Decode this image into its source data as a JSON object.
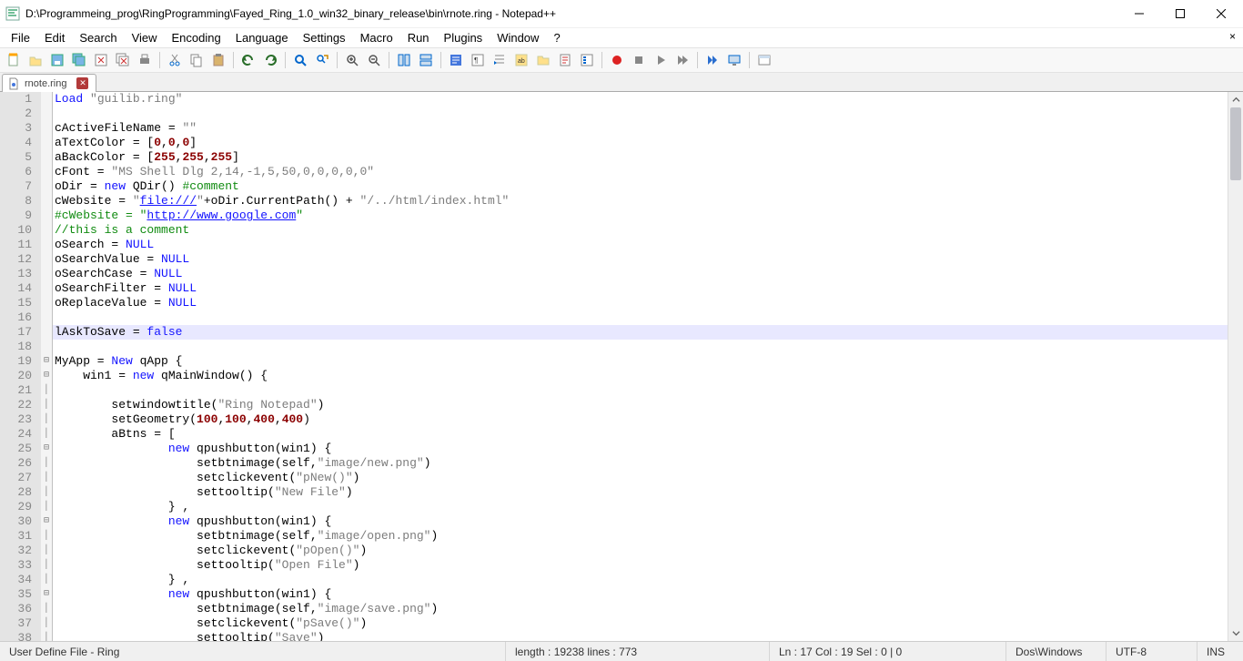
{
  "window": {
    "title": "D:\\Programmeing_prog\\RingProgramming\\Fayed_Ring_1.0_win32_binary_release\\bin\\rnote.ring - Notepad++"
  },
  "menu": {
    "items": [
      "File",
      "Edit",
      "Search",
      "View",
      "Encoding",
      "Language",
      "Settings",
      "Macro",
      "Run",
      "Plugins",
      "Window",
      "?"
    ]
  },
  "tab": {
    "name": "rnote.ring"
  },
  "code": {
    "lines": [
      {
        "n": 1,
        "fold": "",
        "segs": [
          [
            "kw",
            "Load"
          ],
          [
            "",
            " "
          ],
          [
            "str",
            "\"guilib.ring\""
          ]
        ]
      },
      {
        "n": 2,
        "fold": "",
        "segs": [
          [
            "",
            ""
          ]
        ]
      },
      {
        "n": 3,
        "fold": "",
        "segs": [
          [
            "",
            "cActiveFileName = "
          ],
          [
            "str",
            "\"\""
          ]
        ]
      },
      {
        "n": 4,
        "fold": "",
        "segs": [
          [
            "",
            "aTextColor = ["
          ],
          [
            "num",
            "0"
          ],
          [
            "",
            ","
          ],
          [
            "num",
            "0"
          ],
          [
            "",
            ","
          ],
          [
            "num",
            "0"
          ],
          [
            "",
            "]"
          ]
        ]
      },
      {
        "n": 5,
        "fold": "",
        "segs": [
          [
            "",
            "aBackColor = ["
          ],
          [
            "num",
            "255"
          ],
          [
            "",
            ","
          ],
          [
            "num",
            "255"
          ],
          [
            "",
            ","
          ],
          [
            "num",
            "255"
          ],
          [
            "",
            "]"
          ]
        ]
      },
      {
        "n": 6,
        "fold": "",
        "segs": [
          [
            "",
            "cFont = "
          ],
          [
            "str",
            "\"MS Shell Dlg 2,14,-1,5,50,0,0,0,0,0\""
          ]
        ]
      },
      {
        "n": 7,
        "fold": "",
        "segs": [
          [
            "",
            "oDir = "
          ],
          [
            "kw",
            "new"
          ],
          [
            "",
            " QDir() "
          ],
          [
            "cmt",
            "#comment"
          ]
        ]
      },
      {
        "n": 8,
        "fold": "",
        "segs": [
          [
            "",
            "cWebsite = "
          ],
          [
            "str",
            "\""
          ],
          [
            "lnk",
            "file:///"
          ],
          [
            "str",
            "\""
          ],
          [
            "",
            "+oDir.CurrentPath() + "
          ],
          [
            "str",
            "\"/../html/index.html\""
          ]
        ]
      },
      {
        "n": 9,
        "fold": "",
        "segs": [
          [
            "cmt",
            "#cWebsite = \""
          ],
          [
            "lnk",
            "http://www.google.com"
          ],
          [
            "cmt",
            "\""
          ]
        ]
      },
      {
        "n": 10,
        "fold": "",
        "segs": [
          [
            "cmt",
            "//this is a comment"
          ]
        ]
      },
      {
        "n": 11,
        "fold": "",
        "segs": [
          [
            "",
            "oSearch = "
          ],
          [
            "nul",
            "NULL"
          ]
        ]
      },
      {
        "n": 12,
        "fold": "",
        "segs": [
          [
            "",
            "oSearchValue = "
          ],
          [
            "nul",
            "NULL"
          ]
        ]
      },
      {
        "n": 13,
        "fold": "",
        "segs": [
          [
            "",
            "oSearchCase = "
          ],
          [
            "nul",
            "NULL"
          ]
        ]
      },
      {
        "n": 14,
        "fold": "",
        "segs": [
          [
            "",
            "oSearchFilter = "
          ],
          [
            "nul",
            "NULL"
          ]
        ]
      },
      {
        "n": 15,
        "fold": "",
        "segs": [
          [
            "",
            "oReplaceValue = "
          ],
          [
            "nul",
            "NULL"
          ]
        ]
      },
      {
        "n": 16,
        "fold": "",
        "segs": [
          [
            "",
            ""
          ]
        ]
      },
      {
        "n": 17,
        "hl": true,
        "fold": "",
        "segs": [
          [
            "",
            "lAskToSave = "
          ],
          [
            "kw",
            "false"
          ]
        ]
      },
      {
        "n": 18,
        "fold": "",
        "segs": [
          [
            "",
            ""
          ]
        ]
      },
      {
        "n": 19,
        "fold": "⊟",
        "segs": [
          [
            "",
            "MyApp = "
          ],
          [
            "kw",
            "New"
          ],
          [
            "",
            " qApp {"
          ]
        ]
      },
      {
        "n": 20,
        "fold": "⊟",
        "segs": [
          [
            "",
            "    win1 = "
          ],
          [
            "kw",
            "new"
          ],
          [
            "",
            " qMainWindow() {"
          ]
        ]
      },
      {
        "n": 21,
        "fold": "│",
        "segs": [
          [
            "",
            ""
          ]
        ]
      },
      {
        "n": 22,
        "fold": "│",
        "segs": [
          [
            "",
            "        setwindowtitle("
          ],
          [
            "str",
            "\"Ring Notepad\""
          ],
          [
            "",
            ")"
          ]
        ]
      },
      {
        "n": 23,
        "fold": "│",
        "segs": [
          [
            "",
            "        setGeometry("
          ],
          [
            "num",
            "100"
          ],
          [
            "",
            ","
          ],
          [
            "num",
            "100"
          ],
          [
            "",
            ","
          ],
          [
            "num",
            "400"
          ],
          [
            "",
            ","
          ],
          [
            "num",
            "400"
          ],
          [
            "",
            ")"
          ]
        ]
      },
      {
        "n": 24,
        "fold": "│",
        "segs": [
          [
            "",
            "        aBtns = ["
          ]
        ]
      },
      {
        "n": 25,
        "fold": "⊟",
        "segs": [
          [
            "",
            "                "
          ],
          [
            "kw",
            "new"
          ],
          [
            "",
            " qpushbutton(win1) {"
          ]
        ]
      },
      {
        "n": 26,
        "fold": "│",
        "segs": [
          [
            "",
            "                    setbtnimage(self,"
          ],
          [
            "str",
            "\"image/new.png\""
          ],
          [
            "",
            ")"
          ]
        ]
      },
      {
        "n": 27,
        "fold": "│",
        "segs": [
          [
            "",
            "                    setclickevent("
          ],
          [
            "str",
            "\"pNew()\""
          ],
          [
            "",
            ")"
          ]
        ]
      },
      {
        "n": 28,
        "fold": "│",
        "segs": [
          [
            "",
            "                    settooltip("
          ],
          [
            "str",
            "\"New File\""
          ],
          [
            "",
            ")"
          ]
        ]
      },
      {
        "n": 29,
        "fold": "│",
        "segs": [
          [
            "",
            "                } ,"
          ]
        ]
      },
      {
        "n": 30,
        "fold": "⊟",
        "segs": [
          [
            "",
            "                "
          ],
          [
            "kw",
            "new"
          ],
          [
            "",
            " qpushbutton(win1) {"
          ]
        ]
      },
      {
        "n": 31,
        "fold": "│",
        "segs": [
          [
            "",
            "                    setbtnimage(self,"
          ],
          [
            "str",
            "\"image/open.png\""
          ],
          [
            "",
            ")"
          ]
        ]
      },
      {
        "n": 32,
        "fold": "│",
        "segs": [
          [
            "",
            "                    setclickevent("
          ],
          [
            "str",
            "\"pOpen()\""
          ],
          [
            "",
            ")"
          ]
        ]
      },
      {
        "n": 33,
        "fold": "│",
        "segs": [
          [
            "",
            "                    settooltip("
          ],
          [
            "str",
            "\"Open File\""
          ],
          [
            "",
            ")"
          ]
        ]
      },
      {
        "n": 34,
        "fold": "│",
        "segs": [
          [
            "",
            "                } ,"
          ]
        ]
      },
      {
        "n": 35,
        "fold": "⊟",
        "segs": [
          [
            "",
            "                "
          ],
          [
            "kw",
            "new"
          ],
          [
            "",
            " qpushbutton(win1) {"
          ]
        ]
      },
      {
        "n": 36,
        "fold": "│",
        "segs": [
          [
            "",
            "                    setbtnimage(self,"
          ],
          [
            "str",
            "\"image/save.png\""
          ],
          [
            "",
            ")"
          ]
        ]
      },
      {
        "n": 37,
        "fold": "│",
        "segs": [
          [
            "",
            "                    setclickevent("
          ],
          [
            "str",
            "\"pSave()\""
          ],
          [
            "",
            ")"
          ]
        ]
      },
      {
        "n": 38,
        "fold": "│",
        "segs": [
          [
            "",
            "                    settooltip("
          ],
          [
            "str",
            "\"Save\""
          ],
          [
            "",
            ")"
          ]
        ]
      }
    ]
  },
  "status": {
    "language": "User Define File - Ring",
    "length": "length : 19238    lines : 773",
    "pos": "Ln : 17    Col : 19    Sel : 0 | 0",
    "eol": "Dos\\Windows",
    "enc": "UTF-8",
    "ins": "INS"
  },
  "toolbar_icons": [
    "new-icon",
    "open-icon",
    "save-icon",
    "save-all-icon",
    "close-icon",
    "close-all-icon",
    "print-icon",
    "sep",
    "cut-icon",
    "copy-icon",
    "paste-icon",
    "sep",
    "undo-icon",
    "redo-icon",
    "sep",
    "find-icon",
    "replace-icon",
    "sep",
    "zoom-in-icon",
    "zoom-out-icon",
    "sep",
    "sync-v-icon",
    "sync-h-icon",
    "sep",
    "wrap-icon",
    "chars-icon",
    "indent-icon",
    "lang-icon",
    "folder-icon",
    "doc-map-icon",
    "func-list-icon",
    "sep",
    "record-icon",
    "stop-icon",
    "play-icon",
    "play-multi-icon",
    "sep",
    "ff-icon",
    "monitor-icon",
    "sep",
    "panel-icon"
  ]
}
